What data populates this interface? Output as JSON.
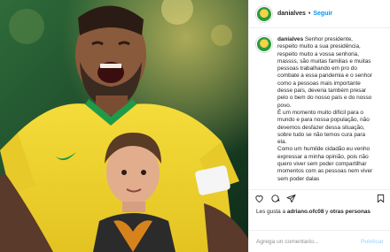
{
  "post": {
    "username": "danialves",
    "separator": "•",
    "follow_label": "Seguir"
  },
  "caption": {
    "username": "danialves",
    "lines": [
      "Senhor presidente,",
      "respeito muito a sua presidência,",
      "respeito muito a vossa senhoria,",
      "massss, são muitas familias e muitas",
      "pessoas trabalhando em pro do",
      "combate a essa pandemia e o senhor",
      "como a pessoas mais importante",
      "desse país, deveria também presar",
      "pelo o bem do nosso país e do nosso",
      "povo.",
      "É um momento muito difícil para o",
      "mundo e para nossa população, não",
      "devemos desfazer dessa situação,",
      "sobre tudo se não temos cura para",
      "ela.",
      "Como um humilde cidadão eu venho",
      "expressar a minha opinião, pois não",
      "quero viver sem poder compartilhar",
      "momentos com as pessoas nem viver",
      "sem poder dalas"
    ]
  },
  "actions": {
    "like_icon": "heart-icon",
    "comment_icon": "comment-icon",
    "share_icon": "share-icon",
    "save_icon": "bookmark-icon"
  },
  "likes": {
    "prefix": "Les gusta a",
    "user": "adriano.ofc08",
    "middle": "y",
    "others": "otras personas"
  },
  "date": "",
  "comment": {
    "placeholder": "Agrega un comentario...",
    "publish_label": "Publicar"
  },
  "colors": {
    "accent": "#0095f6",
    "publish_disabled": "#b2dffc",
    "jersey_yellow": "#f2d52f",
    "jersey_green": "#1f9a48"
  }
}
